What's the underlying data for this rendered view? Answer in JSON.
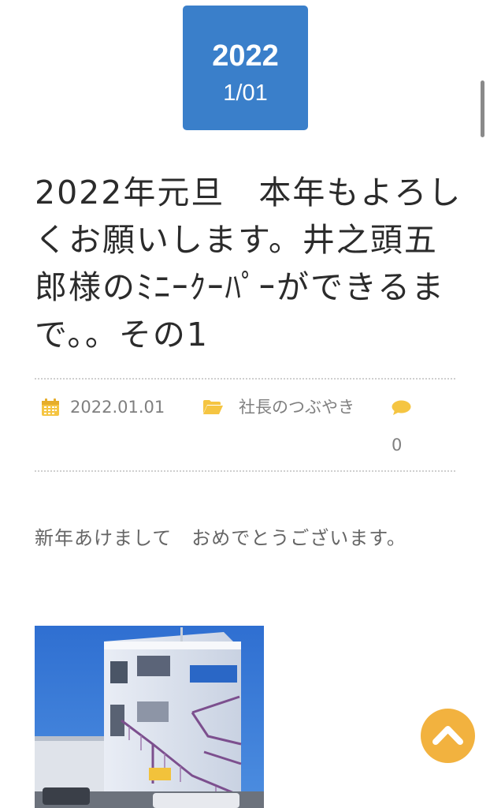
{
  "post": {
    "date_badge": {
      "year": "2022",
      "month_day": "1/01"
    },
    "title": "2022年元旦　本年もよろしくお願いします。井之頭五郎様のﾐﾆｰｸｰﾊﾟｰができるまで。。その1",
    "meta": {
      "date": "2022.01.01",
      "category": "社長のつぶやき",
      "comment_count": "0"
    },
    "body_text": "新年あけまして　おめでとうございます。"
  },
  "colors": {
    "badge": "#3a7fca",
    "meta_icon": "#f5c542",
    "to_top_button": "#f2b23f"
  },
  "icons": {
    "date": "calendar-icon",
    "category": "folder-open-icon",
    "comments": "comment-bubble-icon",
    "to_top": "chevron-up-icon"
  }
}
